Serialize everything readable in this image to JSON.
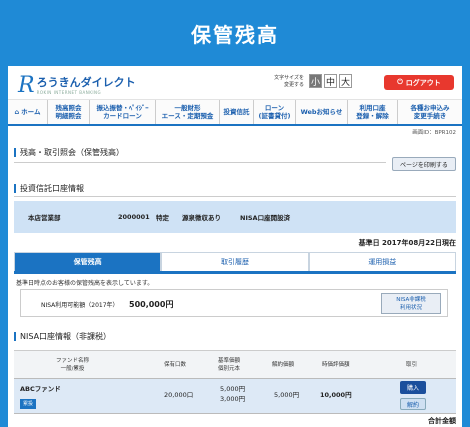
{
  "banner": {
    "title": "保管残高"
  },
  "header": {
    "logo_main": "ろうきんダイレクト",
    "logo_sub": "ROKIN INTERNET BANKING",
    "font_size_label": "文字サイズを\n変更する",
    "font_sizes": [
      "小",
      "中",
      "大"
    ],
    "logout_label": "ログアウト"
  },
  "nav": {
    "items": [
      {
        "label": "ホーム",
        "icon": "home-icon"
      },
      {
        "label": "残高照会\n明細照会"
      },
      {
        "label": "振込振替・ﾍﾟｲｼﾞｰ\nカードローン"
      },
      {
        "label": "一般財形\nエース・定期預金"
      },
      {
        "label": "投資信託"
      },
      {
        "label": "ローン\n(証書貸付)"
      },
      {
        "label": "Webお知らせ"
      },
      {
        "label": "利用口座\n登録・解除"
      },
      {
        "label": "各種お申込み\n変更手続き"
      }
    ]
  },
  "page": {
    "screen_id": "画面ID：BPR102",
    "title": "残高・取引照会（保管残高）",
    "print_button": "ページを印刷する",
    "account_section_title": "投資信託口座情報",
    "account": {
      "branch": "本店営業部",
      "number": "2000001",
      "type": "特定",
      "withholding": "源泉徴収あり",
      "nisa": "NISA口座開設済"
    },
    "base_date": "基準日 2017年08月22日現在",
    "tabs": [
      "保管残高",
      "取引履歴",
      "運用損益"
    ],
    "notice": "基準日時点のお客様の保管残高を表示しています。",
    "nisa_limit_label": "NISA利用可能額（2017年）",
    "nisa_limit_value": "500,000円",
    "nisa_button": "NISA非課税\n利用状況",
    "nisa_section_title": "NISA口座情報（非課税）",
    "columns": [
      "ファンド名称\n一般/累投",
      "保有口数",
      "基準価額\n個別元本",
      "解約価額",
      "時価評価額",
      "取引"
    ],
    "row": {
      "fund": "ABCファンド",
      "badge": "累投",
      "units": "20,000口",
      "nav": "5,000円",
      "cost": "3,000円",
      "redemption": "5,000円",
      "market_value": "10,000円",
      "buy": "購入",
      "sell": "解約"
    },
    "total_label": "合計金額"
  }
}
